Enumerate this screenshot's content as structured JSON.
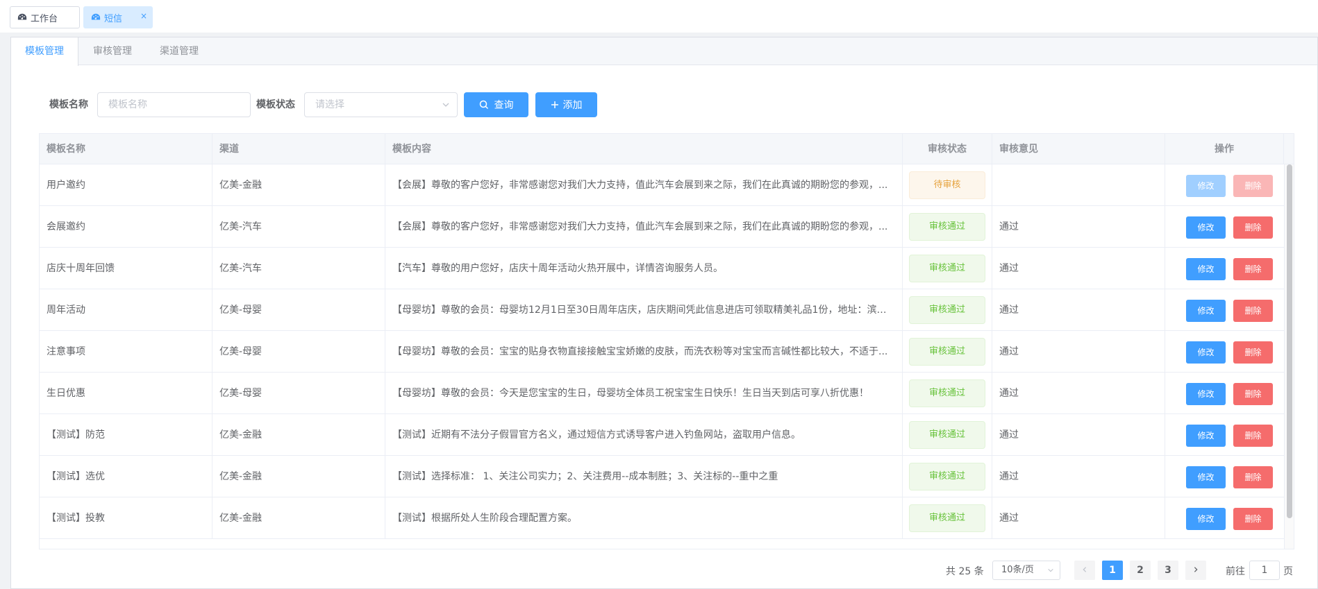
{
  "tags": [
    {
      "label": "工作台",
      "icon": "dashboard-icon",
      "active": false
    },
    {
      "label": "短信",
      "icon": "dashboard-icon",
      "active": true,
      "close": "×"
    }
  ],
  "tabs": [
    "模板管理",
    "审核管理",
    "渠道管理"
  ],
  "search": {
    "name_label": "模板名称",
    "name_placeholder": "模板名称",
    "status_label": "模板状态",
    "status_placeholder": "请选择",
    "query_label": "查询",
    "add_label": "添加"
  },
  "table": {
    "headers": [
      "模板名称",
      "渠道",
      "模板内容",
      "审核状态",
      "审核意见",
      "操作"
    ],
    "rows": [
      {
        "name": "用户邀约",
        "channel": "亿美-金融",
        "content": "【会展】尊敬的客户您好，非常感谢您对我们大力支持，值此汽车会展到来之际，我们在此真诚的期盼您的参观，...",
        "status": "待审核",
        "status_type": "wait",
        "opinion": "",
        "disabled": true
      },
      {
        "name": "会展邀约",
        "channel": "亿美-汽车",
        "content": "【会展】尊敬的客户您好，非常感谢您对我们大力支持，值此汽车会展到来之际，我们在此真诚的期盼您的参观，...",
        "status": "审核通过",
        "status_type": "ok",
        "opinion": "通过",
        "disabled": false
      },
      {
        "name": "店庆十周年回馈",
        "channel": "亿美-汽车",
        "content": "【汽车】尊敬的用户您好，店庆十周年活动火热开展中，详情咨询服务人员。",
        "status": "审核通过",
        "status_type": "ok",
        "opinion": "通过",
        "disabled": false
      },
      {
        "name": "周年活动",
        "channel": "亿美-母婴",
        "content": "【母婴坊】尊敬的会员：母婴坊12月1日至30日周年店庆，店庆期间凭此信息进店可领取精美礼品1份，地址：滨江...",
        "status": "审核通过",
        "status_type": "ok",
        "opinion": "通过",
        "disabled": false
      },
      {
        "name": "注意事项",
        "channel": "亿美-母婴",
        "content": "【母婴坊】尊敬的会员：宝宝的贴身衣物直接接触宝宝娇嫩的皮肤，而洗衣粉等对宝宝而言碱性都比较大，不适于...",
        "status": "审核通过",
        "status_type": "ok",
        "opinion": "通过",
        "disabled": false
      },
      {
        "name": "生日优惠",
        "channel": "亿美-母婴",
        "content": "【母婴坊】尊敬的会员：今天是您宝宝的生日，母婴坊全体员工祝宝宝生日快乐！生日当天到店可享八折优惠！",
        "status": "审核通过",
        "status_type": "ok",
        "opinion": "通过",
        "disabled": false
      },
      {
        "name": "【测试】防范",
        "channel": "亿美-金融",
        "content": "【测试】近期有不法分子假冒官方名义，通过短信方式诱导客户进入钓鱼网站，盗取用户信息。",
        "status": "审核通过",
        "status_type": "ok",
        "opinion": "通过",
        "disabled": false
      },
      {
        "name": "【测试】选优",
        "channel": "亿美-金融",
        "content": "【测试】选择标准： 1、关注公司实力；2、关注费用--成本制胜；3、关注标的--重中之重",
        "status": "审核通过",
        "status_type": "ok",
        "opinion": "通过",
        "disabled": false
      },
      {
        "name": "【测试】投教",
        "channel": "亿美-金融",
        "content": "【测试】根据所处人生阶段合理配置方案。",
        "status": "审核通过",
        "status_type": "ok",
        "opinion": "通过",
        "disabled": false
      }
    ],
    "edit_label": "修改",
    "delete_label": "删除"
  },
  "pagination": {
    "total": "共 25 条",
    "page_size": "10条/页",
    "pages": [
      "1",
      "2",
      "3"
    ],
    "current": "1",
    "goto_prefix": "前往",
    "goto_value": "1",
    "goto_suffix": "页"
  },
  "colors": {
    "primary": "#409eff",
    "danger": "#f56c6c",
    "success": "#67c23a",
    "warning": "#e6a23c"
  }
}
